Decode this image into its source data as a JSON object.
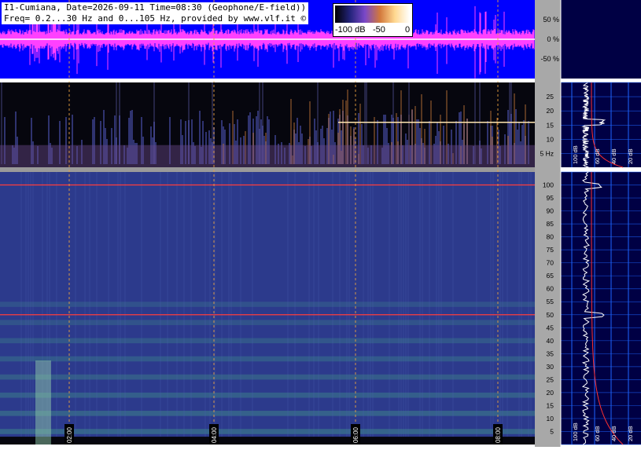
{
  "header": {
    "line1": "I1-Cumiana, Date=2026-09-11 Time=08:30 (Geophone/E-field))",
    "line2": "Freq= 0.2...30 Hz and 0...105 Hz, provided by www.vlf.it ©"
  },
  "color_legend": {
    "labels": [
      "-100 dB",
      "-50",
      "0"
    ],
    "colors": [
      "#000000",
      "#23237a",
      "#7a48c8",
      "#d2783c",
      "#ffd890",
      "#ffffff"
    ]
  },
  "colors": {
    "page_bg": "#ffffff",
    "waveform_bg": "#0000ff",
    "waveform_trace": "#ff40ff",
    "spectrogram_bg": "#2c3a8c",
    "axis_panel": "#a8a8a8",
    "spectrum_panel": "#000044",
    "grid_blue": "#1e64ff",
    "time_marker": "#e8a040",
    "hum_line": "#ff3c3c",
    "spectrum_trace": "#ffffff",
    "spectrum_ref": "#ff3030"
  },
  "chart_data": [
    {
      "type": "line",
      "title": "",
      "ylabel": "",
      "ticks": [
        "50 %",
        "0 %",
        "-50 %"
      ],
      "ylim": [
        -100,
        100
      ]
    },
    {
      "type": "heatmap",
      "title": "",
      "ylabel": "",
      "ticks": [
        "25",
        "20",
        "15",
        "10",
        "5 Hz"
      ],
      "ylim": [
        0.2,
        30
      ],
      "line_hz": 16
    },
    {
      "type": "heatmap",
      "title": "",
      "ylabel": "",
      "ticks": [
        "100",
        "95",
        "90",
        "85",
        "80",
        "75",
        "70",
        "65",
        "60",
        "55",
        "50",
        "45",
        "40",
        "35",
        "30",
        "25",
        "20",
        "15",
        "10",
        "5"
      ],
      "ylim": [
        0,
        105
      ],
      "hum_hz": [
        50,
        100
      ],
      "time_labels": [
        "02:00",
        "04:00",
        "06:00",
        "08:00"
      ]
    },
    {
      "type": "line",
      "title": "",
      "ylabel": "",
      "xticks": [
        "100 dB",
        "60 dB",
        "40 dB",
        "20 dB"
      ],
      "ylim": [
        0.2,
        30
      ]
    },
    {
      "type": "line",
      "title": "",
      "ylabel": "",
      "xticks": [
        "100 dB",
        "60 dB",
        "40 dB",
        "20 dB"
      ],
      "ylim": [
        0,
        105
      ],
      "peaks_hz": [
        50,
        100
      ]
    }
  ]
}
